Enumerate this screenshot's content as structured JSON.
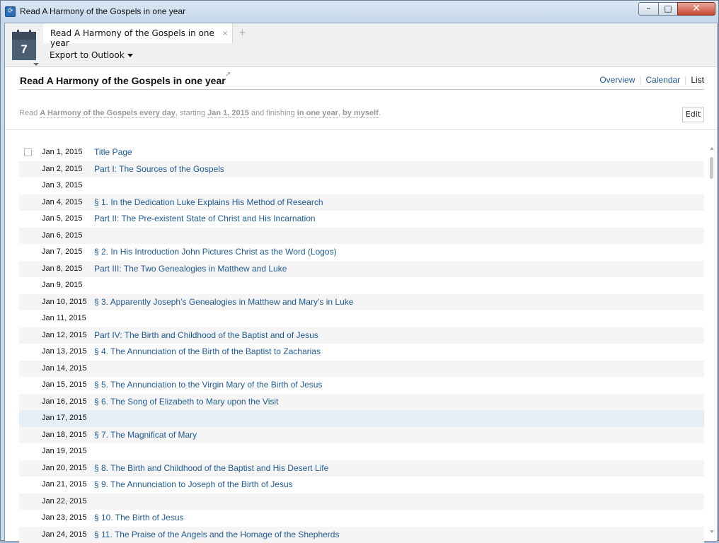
{
  "window": {
    "title": "Read A Harmony of the Gospels in one year",
    "min_label": "–",
    "max_label": "□",
    "close_label": "✕"
  },
  "toolbar": {
    "calendar_icon_number": "7",
    "tab_label": "Read A Harmony of the Gospels in one year",
    "tab_close": "×",
    "tab_add": "+",
    "export_label": "Export to Outlook"
  },
  "plan": {
    "title": "Read A Harmony of the Gospels in one year",
    "edit_pencil": "↗",
    "nav": {
      "overview": "Overview",
      "calendar": "Calendar",
      "list": "List"
    },
    "description": {
      "p1": "Read ",
      "book": "A Harmony of the Gospels",
      "p2": " ",
      "freq": "every day",
      "p3": ", starting ",
      "start": "Jan 1, 2015",
      "p4": " and finishing ",
      "duration": "in one year",
      "p5": ", ",
      "who": "by myself",
      "p6": "."
    },
    "edit_button": "Edit"
  },
  "rows": [
    {
      "date": "Jan 1, 2015",
      "reading": "Title Page"
    },
    {
      "date": "Jan 2, 2015",
      "reading": "Part I: The Sources of the Gospels"
    },
    {
      "date": "Jan 3, 2015",
      "reading": ""
    },
    {
      "date": "Jan 4, 2015",
      "reading": "§ 1. In the Dedication Luke Explains His Method of Research"
    },
    {
      "date": "Jan 5, 2015",
      "reading": "Part II: The Pre-existent State of Christ and His Incarnation"
    },
    {
      "date": "Jan 6, 2015",
      "reading": ""
    },
    {
      "date": "Jan 7, 2015",
      "reading": "§ 2. In His Introduction John Pictures Christ as the Word (Logos)"
    },
    {
      "date": "Jan 8, 2015",
      "reading": "Part III: The Two Genealogies in Matthew and Luke"
    },
    {
      "date": "Jan 9, 2015",
      "reading": ""
    },
    {
      "date": "Jan 10, 2015",
      "reading": "§ 3. Apparently Joseph’s Genealogies in Matthew and Mary’s in Luke"
    },
    {
      "date": "Jan 11, 2015",
      "reading": ""
    },
    {
      "date": "Jan 12, 2015",
      "reading": "Part IV: The Birth and Childhood of the Baptist and of Jesus"
    },
    {
      "date": "Jan 13, 2015",
      "reading": "§ 4. The Annunciation of the Birth of the Baptist to Zacharias"
    },
    {
      "date": "Jan 14, 2015",
      "reading": ""
    },
    {
      "date": "Jan 15, 2015",
      "reading": "§ 5. The Annunciation to the Virgin Mary of the Birth of Jesus"
    },
    {
      "date": "Jan 16, 2015",
      "reading": "§ 6. The Song of Elizabeth to Mary upon the Visit"
    },
    {
      "date": "Jan 17, 2015",
      "reading": ""
    },
    {
      "date": "Jan 18, 2015",
      "reading": "§ 7. The Magnificat of Mary"
    },
    {
      "date": "Jan 19, 2015",
      "reading": ""
    },
    {
      "date": "Jan 20, 2015",
      "reading": "§ 8. The Birth and Childhood of the Baptist and His Desert Life"
    },
    {
      "date": "Jan 21, 2015",
      "reading": "§ 9. The Annunciation to Joseph of the Birth of Jesus"
    },
    {
      "date": "Jan 22, 2015",
      "reading": ""
    },
    {
      "date": "Jan 23, 2015",
      "reading": "§ 10. The Birth of Jesus"
    },
    {
      "date": "Jan 24, 2015",
      "reading": "§ 11. The Praise of the Angels and the Homage of the Shepherds"
    }
  ],
  "colors": {
    "link": "#1f5a96",
    "alt_row": "#f5f5f5",
    "selected_row": "#e6eef8",
    "muted_text": "#9a9a9a"
  }
}
